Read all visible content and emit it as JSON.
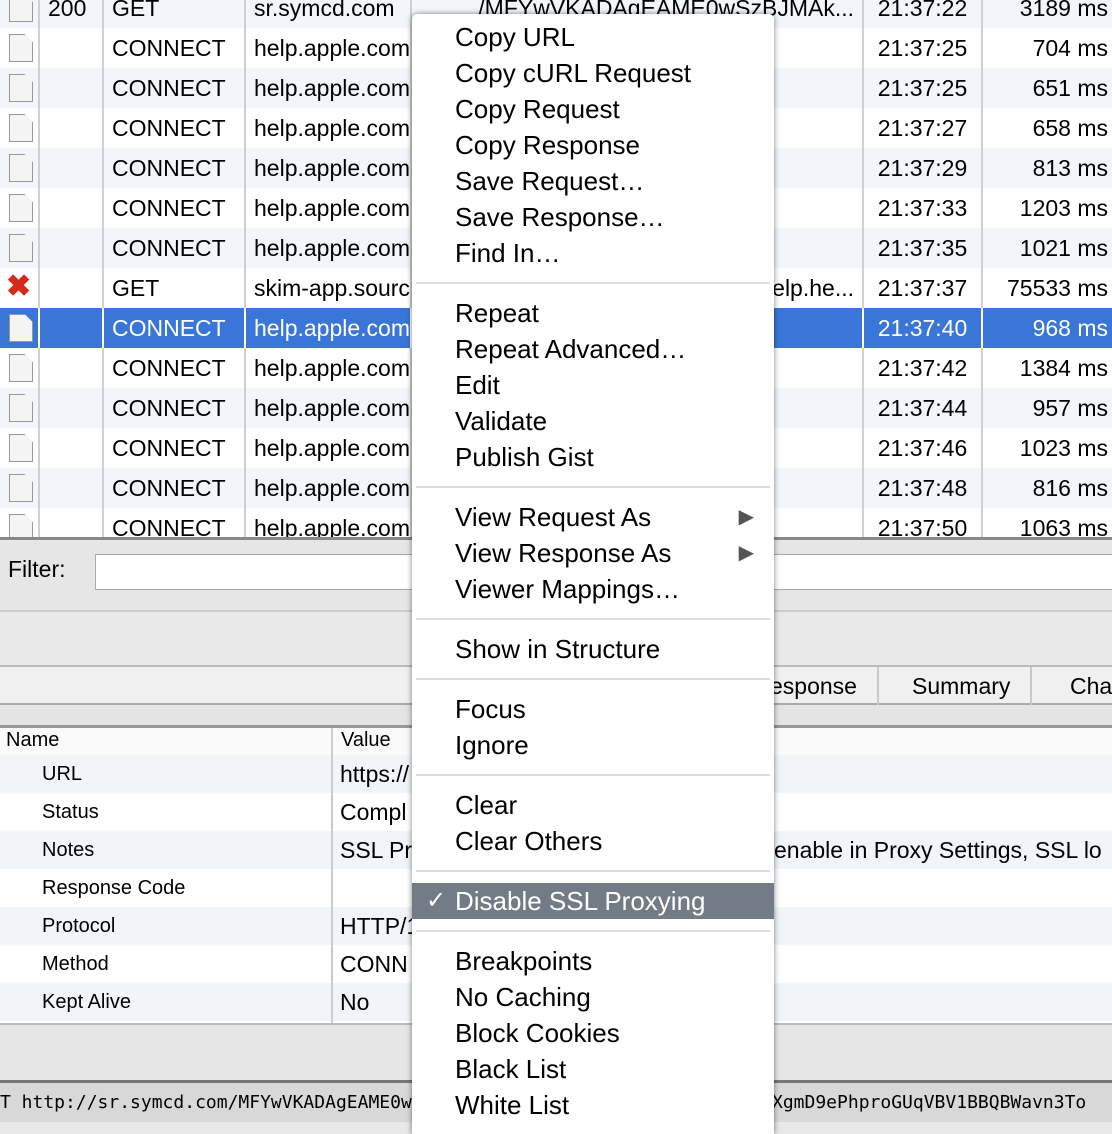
{
  "table": {
    "rows": [
      {
        "icon": "document-icon",
        "status": "200",
        "method": "GET",
        "host": "sr.symcd.com",
        "path": "/MFYwVKADAgEAME0wSzBJMAk...",
        "time": "21:37:22",
        "duration": "3189 ms"
      },
      {
        "icon": "document-icon",
        "status": "",
        "method": "CONNECT",
        "host": "help.apple.com",
        "path": "",
        "time": "21:37:25",
        "duration": "704 ms"
      },
      {
        "icon": "document-icon",
        "status": "",
        "method": "CONNECT",
        "host": "help.apple.com",
        "path": "",
        "time": "21:37:25",
        "duration": "651 ms"
      },
      {
        "icon": "document-icon",
        "status": "",
        "method": "CONNECT",
        "host": "help.apple.com",
        "path": "",
        "time": "21:37:27",
        "duration": "658 ms"
      },
      {
        "icon": "document-icon",
        "status": "",
        "method": "CONNECT",
        "host": "help.apple.com",
        "path": "",
        "time": "21:37:29",
        "duration": "813 ms"
      },
      {
        "icon": "document-icon",
        "status": "",
        "method": "CONNECT",
        "host": "help.apple.com",
        "path": "",
        "time": "21:37:33",
        "duration": "1203 ms"
      },
      {
        "icon": "document-icon",
        "status": "",
        "method": "CONNECT",
        "host": "help.apple.com",
        "path": "",
        "time": "21:37:35",
        "duration": "1021 ms"
      },
      {
        "icon": "error-x-icon",
        "status": "",
        "method": "GET",
        "host": "skim-app.sourc",
        "path": "elp.he...",
        "time": "21:37:37",
        "duration": "75533 ms"
      },
      {
        "icon": "document-icon",
        "status": "",
        "method": "CONNECT",
        "host": "help.apple.com",
        "path": "",
        "time": "21:37:40",
        "duration": "968 ms",
        "selected": true
      },
      {
        "icon": "document-icon",
        "status": "",
        "method": "CONNECT",
        "host": "help.apple.com",
        "path": "",
        "time": "21:37:42",
        "duration": "1384 ms"
      },
      {
        "icon": "document-icon",
        "status": "",
        "method": "CONNECT",
        "host": "help.apple.com",
        "path": "",
        "time": "21:37:44",
        "duration": "957 ms"
      },
      {
        "icon": "document-icon",
        "status": "",
        "method": "CONNECT",
        "host": "help.apple.com",
        "path": "",
        "time": "21:37:46",
        "duration": "1023 ms"
      },
      {
        "icon": "document-icon",
        "status": "",
        "method": "CONNECT",
        "host": "help.apple.com",
        "path": "",
        "time": "21:37:48",
        "duration": "816 ms"
      },
      {
        "icon": "document-icon",
        "status": "",
        "method": "CONNECT",
        "host": "help.apple.com",
        "path": "",
        "time": "21:37:50",
        "duration": "1063 ms"
      }
    ],
    "selected_color": "#3a75d8"
  },
  "filter": {
    "label": "Filter:",
    "value": ""
  },
  "tabs": [
    "esponse",
    "Summary",
    "Cha"
  ],
  "props": {
    "header_name": "Name",
    "header_value": "Value",
    "rows": [
      {
        "name": "URL",
        "value": "https://",
        "right": ""
      },
      {
        "name": "Status",
        "value": "Compl",
        "right": ""
      },
      {
        "name": "Notes",
        "value": "SSL Pr",
        "right": "enable in Proxy Settings, SSL lo"
      },
      {
        "name": "Response Code",
        "value": "",
        "right": ""
      },
      {
        "name": "Protocol",
        "value": "HTTP/1",
        "right": ""
      },
      {
        "name": "Method",
        "value": "CONN",
        "right": ""
      },
      {
        "name": "Kept Alive",
        "value": "No",
        "right": ""
      }
    ]
  },
  "statusbar": {
    "left": "T http://sr.symcd.com/MFYwVKADAgEAME0wS",
    "right": "XgmD9ePhproGUqVBV1BBQBWavn3To"
  },
  "menu": {
    "groups": [
      [
        {
          "label": "Copy URL"
        },
        {
          "label": "Copy cURL Request"
        },
        {
          "label": "Copy Request"
        },
        {
          "label": "Copy Response"
        },
        {
          "label": "Save Request…"
        },
        {
          "label": "Save Response…"
        },
        {
          "label": "Find In…"
        }
      ],
      [
        {
          "label": "Repeat"
        },
        {
          "label": "Repeat Advanced…"
        },
        {
          "label": "Edit"
        },
        {
          "label": "Validate"
        },
        {
          "label": "Publish Gist"
        }
      ],
      [
        {
          "label": "View Request As",
          "submenu": true
        },
        {
          "label": "View Response As",
          "submenu": true
        },
        {
          "label": "Viewer Mappings…"
        }
      ],
      [
        {
          "label": "Show in Structure"
        }
      ],
      [
        {
          "label": "Focus"
        },
        {
          "label": "Ignore"
        }
      ],
      [
        {
          "label": "Clear"
        },
        {
          "label": "Clear Others"
        }
      ],
      [
        {
          "label": "Disable SSL Proxying",
          "checked": true,
          "highlighted": true
        }
      ],
      [
        {
          "label": "Breakpoints"
        },
        {
          "label": "No Caching"
        },
        {
          "label": "Block Cookies"
        },
        {
          "label": "Black List"
        },
        {
          "label": "White List"
        }
      ]
    ],
    "highlight_color": "#737b87"
  }
}
